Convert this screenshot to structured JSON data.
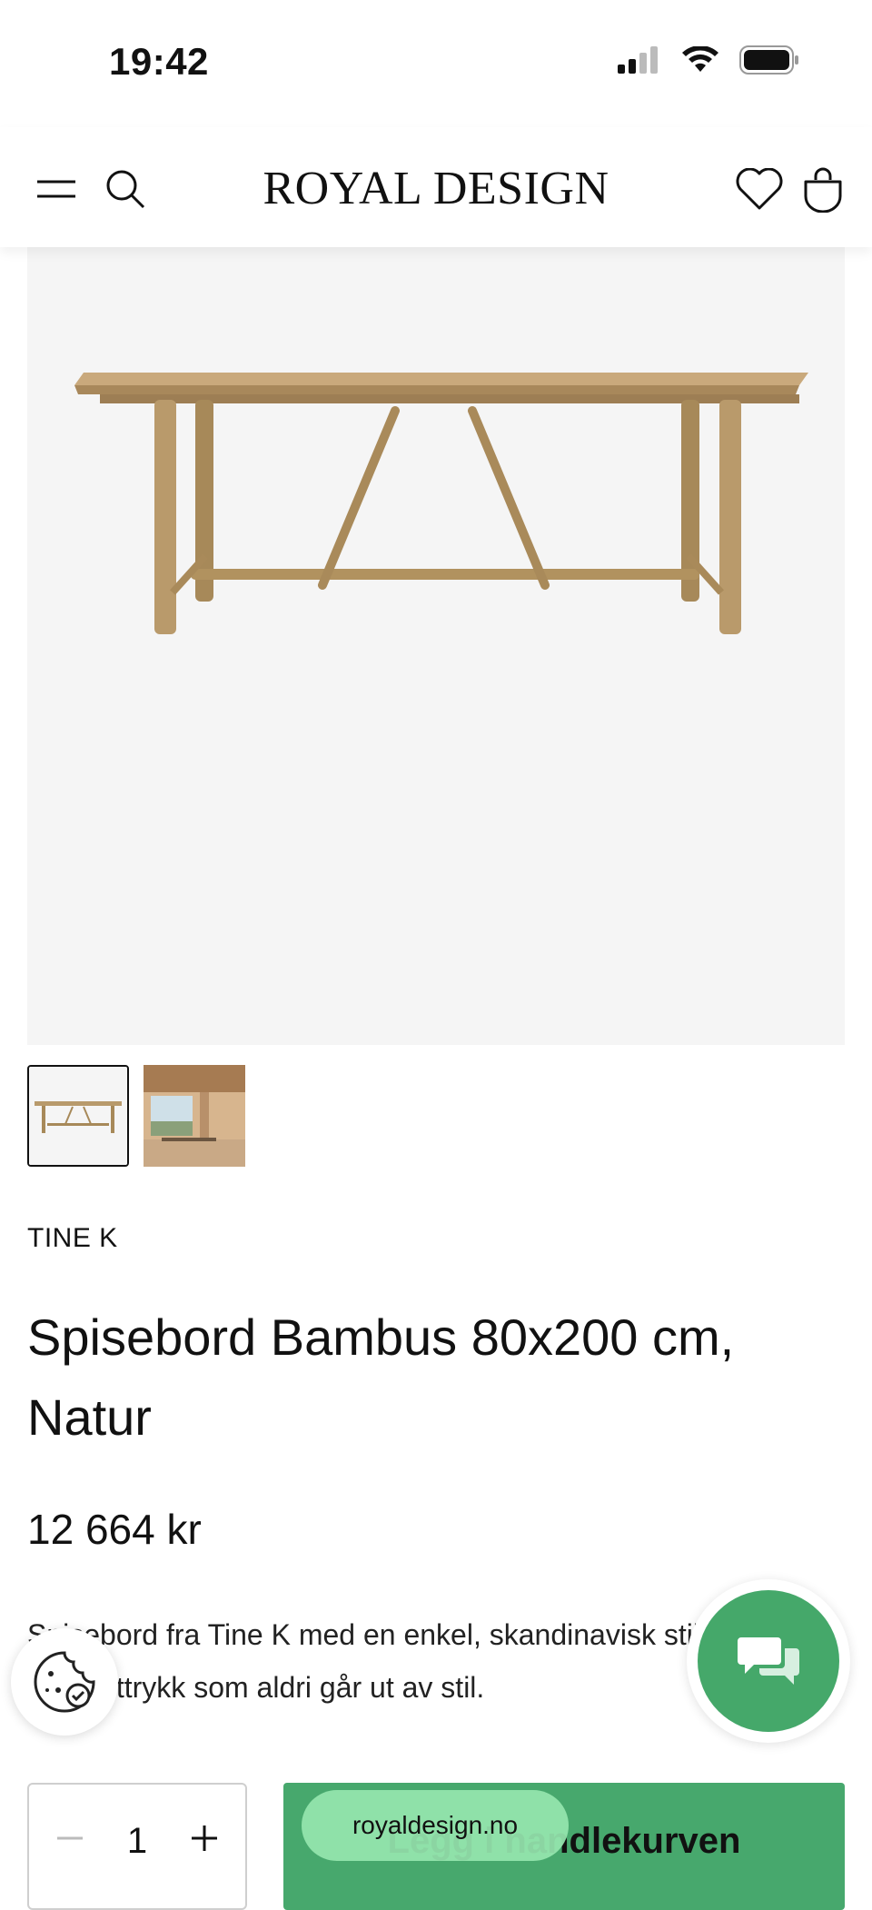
{
  "status_bar": {
    "time": "19:42"
  },
  "header": {
    "logo": "ROYAL DESIGN"
  },
  "product": {
    "brand": "TINE K",
    "title": "Spisebord Bambus 80x200 cm, Natur",
    "price": "12 664 kr",
    "description": "Spisebord fra Tine K med en enkel, skandinavisk stil og et uttrykk som aldri går ut av stil.",
    "gallery": {
      "selected_index": 0,
      "count": 2
    }
  },
  "purchase": {
    "quantity": "1",
    "add_to_cart_label": "Legg i handlekurven"
  },
  "browser": {
    "url": "royaldesign.no"
  },
  "colors": {
    "accent_green": "#47a86d",
    "chat_green": "#45a86a",
    "url_pill": "#96e6af"
  },
  "icons": [
    "menu-icon",
    "search-icon",
    "heart-icon",
    "shopping-bag-icon",
    "chat-icon",
    "cookie-icon"
  ]
}
